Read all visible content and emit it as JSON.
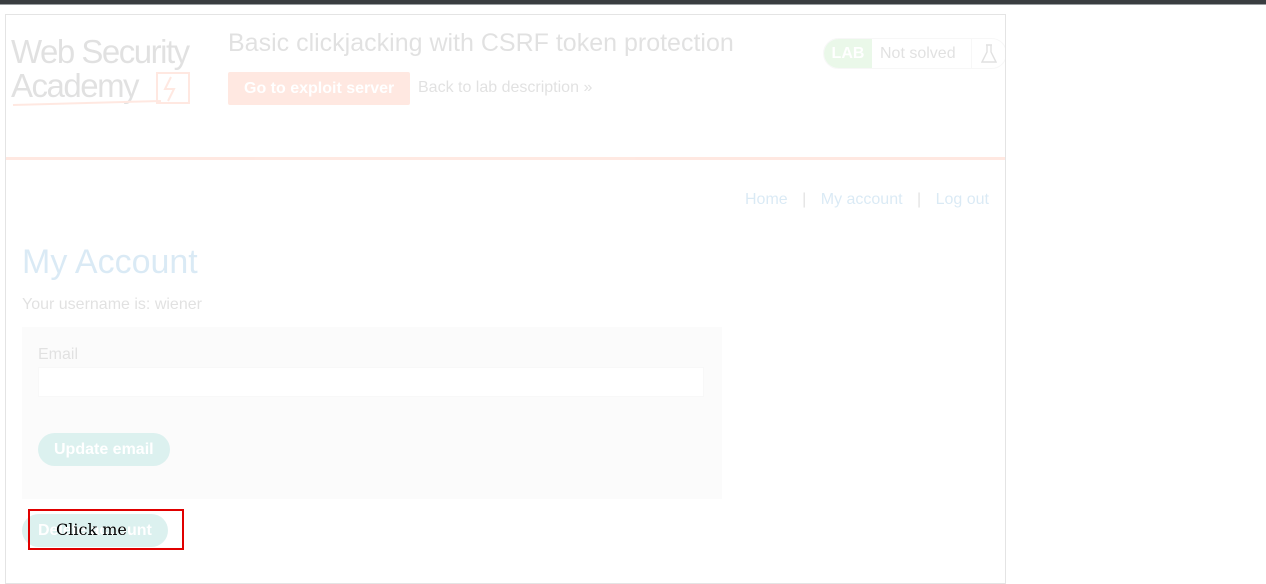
{
  "lab": {
    "title": "Basic clickjacking with CSRF token protection",
    "exploit_button": "Go to exploit server",
    "back_link": "Back to lab description",
    "back_link_icon": "chevron-double-right-icon",
    "badge": "LAB",
    "status": "Not solved",
    "status_icon": "flask-icon"
  },
  "logo": {
    "line1": "Web Security",
    "line2": "Academy",
    "mark": "+"
  },
  "nav": {
    "home": "Home",
    "separator": "|",
    "my_account": "My account",
    "log_out": "Log out"
  },
  "account": {
    "title": "My Account",
    "username_text": "Your username is: wiener",
    "email_label": "Email",
    "email_value": "",
    "update_button": "Update email",
    "delete_button": "Delete account"
  },
  "decoy": {
    "label": "Click me",
    "border_color": "#e00000"
  },
  "colors": {
    "brand_orange": "#ff6633",
    "link_blue": "#0071bc",
    "button_teal": "#0e9f93",
    "lab_green": "#70d16d"
  }
}
